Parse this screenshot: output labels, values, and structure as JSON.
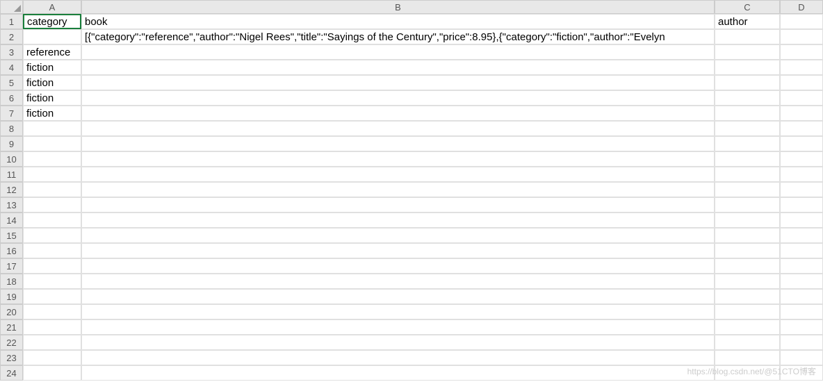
{
  "columns": [
    "A",
    "B",
    "C",
    "D"
  ],
  "rows": [
    1,
    2,
    3,
    4,
    5,
    6,
    7,
    8,
    9,
    10,
    11,
    12,
    13,
    14,
    15,
    16,
    17,
    18,
    19,
    20,
    21,
    22,
    23,
    24
  ],
  "activeCell": "A1",
  "cells": {
    "A1": "category",
    "B1": "book",
    "C1": "author",
    "B2": "[{\"category\":\"reference\",\"author\":\"Nigel Rees\",\"title\":\"Sayings of the Century\",\"price\":8.95},{\"category\":\"fiction\",\"author\":\"Evelyn",
    "A3": "reference",
    "A4": "fiction",
    "A5": "fiction",
    "A6": "fiction",
    "A7": "fiction"
  },
  "watermark": "https://blog.csdn.net/@51CTO博客"
}
